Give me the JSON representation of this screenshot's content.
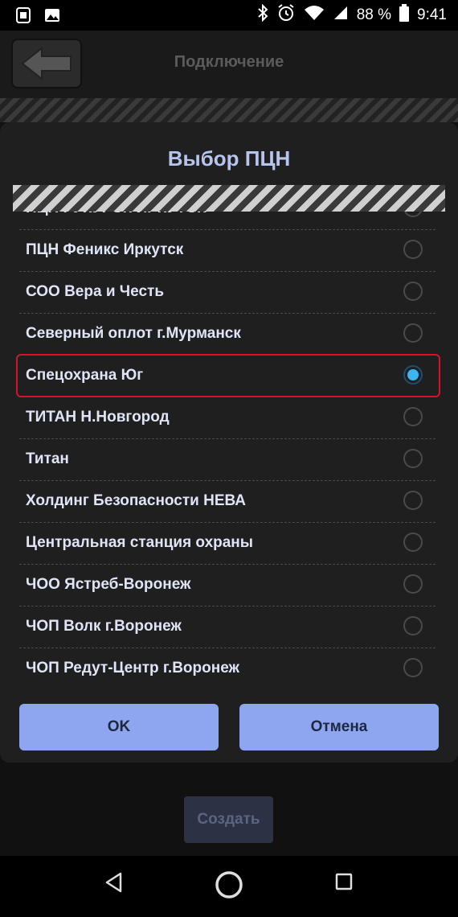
{
  "status_bar": {
    "battery": "88 %",
    "time": "9:41",
    "icons": [
      "notification-icon",
      "image-icon",
      "bluetooth-icon",
      "alarm-icon",
      "wifi-icon",
      "signal-icon",
      "battery-icon"
    ]
  },
  "app": {
    "title": "Подключение",
    "create_label": "Создать"
  },
  "dialog": {
    "title": "Выбор ПЦН",
    "partial_item": "ПЦН РУКУРСК ИРКУТСК",
    "items": [
      {
        "label": "ПЦН Феникс Иркутск",
        "checked": false
      },
      {
        "label": "СОО Вера и Честь",
        "checked": false
      },
      {
        "label": "Северный оплот г.Мурманск",
        "checked": false
      },
      {
        "label": "Спецохрана Юг",
        "checked": true
      },
      {
        "label": "ТИТАН Н.Новгород",
        "checked": false
      },
      {
        "label": "Титан",
        "checked": false
      },
      {
        "label": "Холдинг Безопасности НЕВА",
        "checked": false
      },
      {
        "label": "Центральная станция охраны",
        "checked": false
      },
      {
        "label": "ЧОО Ястреб-Воронеж",
        "checked": false
      },
      {
        "label": "ЧОП Волк г.Воронеж",
        "checked": false
      },
      {
        "label": "ЧОП Редут-Центр г.Воронеж",
        "checked": false
      }
    ],
    "ok_label": "OK",
    "cancel_label": "Отмена"
  },
  "colors": {
    "accent": "#8ea6f0",
    "selected": "#3ab4f2",
    "highlight": "#d8112c"
  }
}
